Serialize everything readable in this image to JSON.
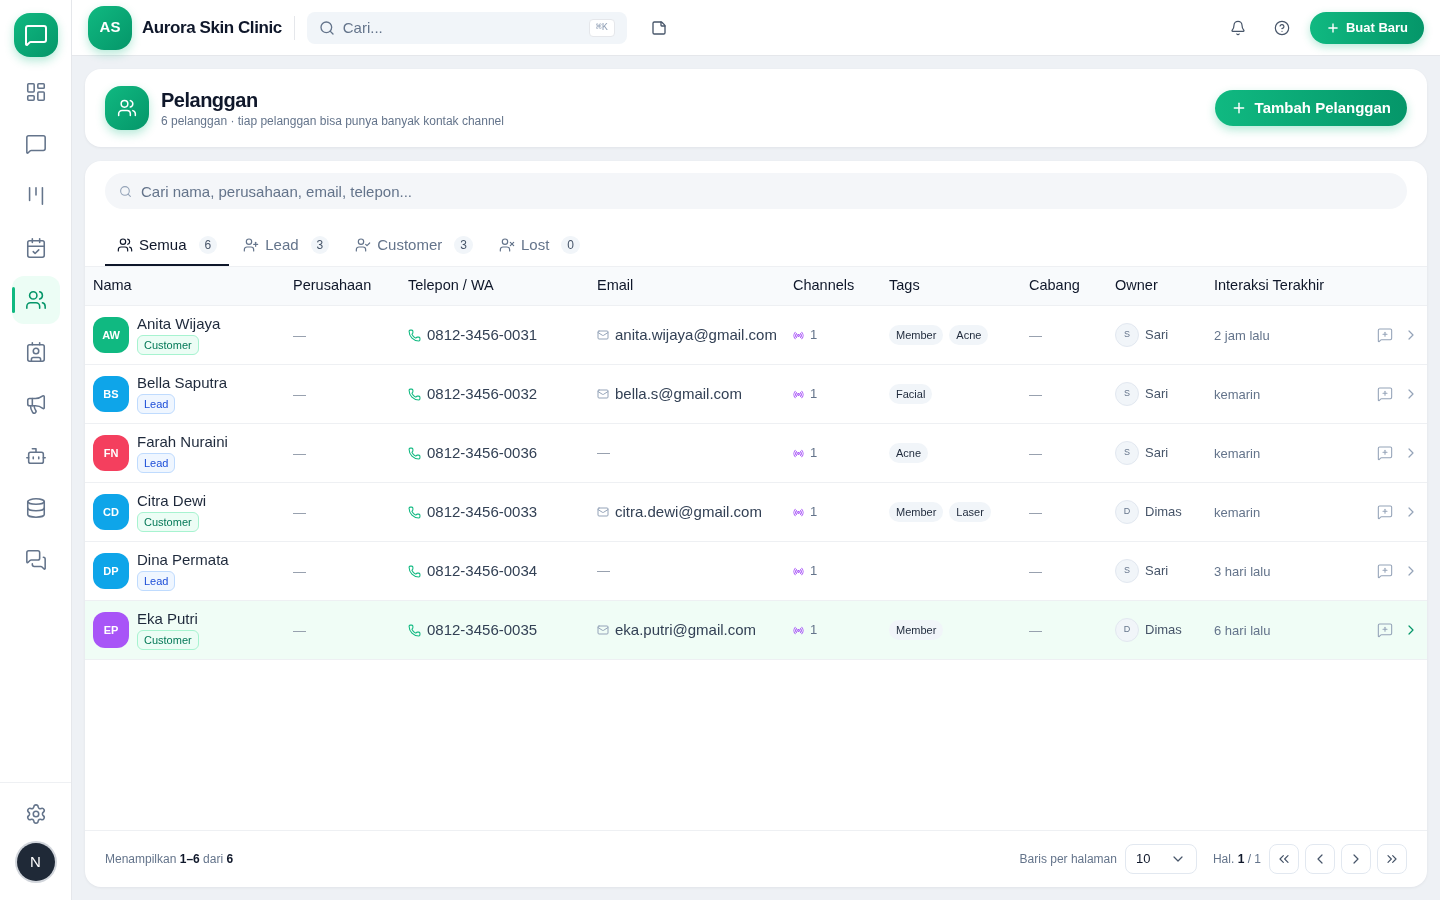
{
  "sidebar": {
    "nav_items": [
      {
        "selected": false
      },
      {
        "selected": false
      },
      {
        "selected": false
      },
      {
        "selected": false
      },
      {
        "selected": true
      },
      {
        "selected": false
      },
      {
        "selected": false
      },
      {
        "selected": false
      },
      {
        "selected": false
      },
      {
        "selected": false
      }
    ],
    "user_avatar": "N"
  },
  "header": {
    "workspace": {
      "initials": "AS",
      "name": "Aurora Skin Clinic"
    },
    "search": {
      "placeholder": "Cari...",
      "shortcut": "⌘K"
    },
    "create_button": "Buat Baru"
  },
  "page_header": {
    "title": "Pelanggan",
    "subtitle": "6 pelanggan · tiap pelanggan bisa punya banyak kontak channel",
    "add_button": "Tambah Pelanggan"
  },
  "customers": {
    "search": {
      "placeholder": "Cari nama, perusahaan, email, telepon..."
    },
    "tabs": [
      {
        "label": "Semua",
        "count": "6",
        "selected": true
      },
      {
        "label": "Lead",
        "count": "3",
        "selected": false
      },
      {
        "label": "Customer",
        "count": "3",
        "selected": false
      },
      {
        "label": "Lost",
        "count": "0",
        "selected": false
      }
    ],
    "table": {
      "columns": [
        "Nama",
        "Perusahaan",
        "Telepon / WA",
        "Email",
        "Channels",
        "Tags",
        "Cabang",
        "Owner",
        "Interaksi Terakhir"
      ],
      "rows": [
        {
          "initials": "AW",
          "color": "#10b981",
          "name": "Anita Wijaya",
          "status": {
            "label": "Customer",
            "kind": "customer"
          },
          "company": "—",
          "phone": "0812-3456-0031",
          "email": {
            "text": "anita.wijaya@gmail.com",
            "kind": "address"
          },
          "channels": "1",
          "tags": [
            "Member",
            "Acne"
          ],
          "branch": "—",
          "owner": {
            "initial": "S",
            "name": "Sari"
          },
          "last_interaction": "2 jam lalu",
          "selected": false
        },
        {
          "initials": "BS",
          "color": "#0ea5e9",
          "name": "Bella Saputra",
          "status": {
            "label": "Lead",
            "kind": "lead"
          },
          "company": "—",
          "phone": "0812-3456-0032",
          "email": {
            "text": "bella.s@gmail.com",
            "kind": "address"
          },
          "channels": "1",
          "tags": [
            "Facial"
          ],
          "branch": "—",
          "owner": {
            "initial": "S",
            "name": "Sari"
          },
          "last_interaction": "kemarin",
          "selected": false
        },
        {
          "initials": "FN",
          "color": "#f43f5e",
          "name": "Farah Nuraini",
          "status": {
            "label": "Lead",
            "kind": "lead"
          },
          "company": "—",
          "phone": "0812-3456-0036",
          "email": {
            "text": "—",
            "kind": "none"
          },
          "channels": "1",
          "tags": [
            "Acne"
          ],
          "branch": "—",
          "owner": {
            "initial": "S",
            "name": "Sari"
          },
          "last_interaction": "kemarin",
          "selected": false
        },
        {
          "initials": "CD",
          "color": "#0ea5e9",
          "name": "Citra Dewi",
          "status": {
            "label": "Customer",
            "kind": "customer"
          },
          "company": "—",
          "phone": "0812-3456-0033",
          "email": {
            "text": "citra.dewi@gmail.com",
            "kind": "address"
          },
          "channels": "1",
          "tags": [
            "Member",
            "Laser"
          ],
          "branch": "—",
          "owner": {
            "initial": "D",
            "name": "Dimas"
          },
          "last_interaction": "kemarin",
          "selected": false
        },
        {
          "initials": "DP",
          "color": "#0ea5e9",
          "name": "Dina Permata",
          "status": {
            "label": "Lead",
            "kind": "lead"
          },
          "company": "—",
          "phone": "0812-3456-0034",
          "email": {
            "text": "—",
            "kind": "none"
          },
          "channels": "1",
          "branch": "—",
          "owner": {
            "initial": "S",
            "name": "Sari"
          },
          "last_interaction": "3 hari lalu",
          "selected": false
        },
        {
          "initials": "EP",
          "color": "#a855f7",
          "name": "Eka Putri",
          "status": {
            "label": "Customer",
            "kind": "customer"
          },
          "company": "—",
          "phone": "0812-3456-0035",
          "email": {
            "text": "eka.putri@gmail.com",
            "kind": "address"
          },
          "channels": "1",
          "tags": [
            "Member"
          ],
          "branch": "—",
          "owner": {
            "initial": "D",
            "name": "Dimas"
          },
          "last_interaction": "6 hari lalu",
          "selected": true
        }
      ]
    },
    "footer": {
      "summary": "Menampilkan **1–6** dari **6**",
      "rows_per_page_label": "Baris per halaman",
      "rows_per_page": "10",
      "page": "Hal. **1** / 1"
    }
  }
}
